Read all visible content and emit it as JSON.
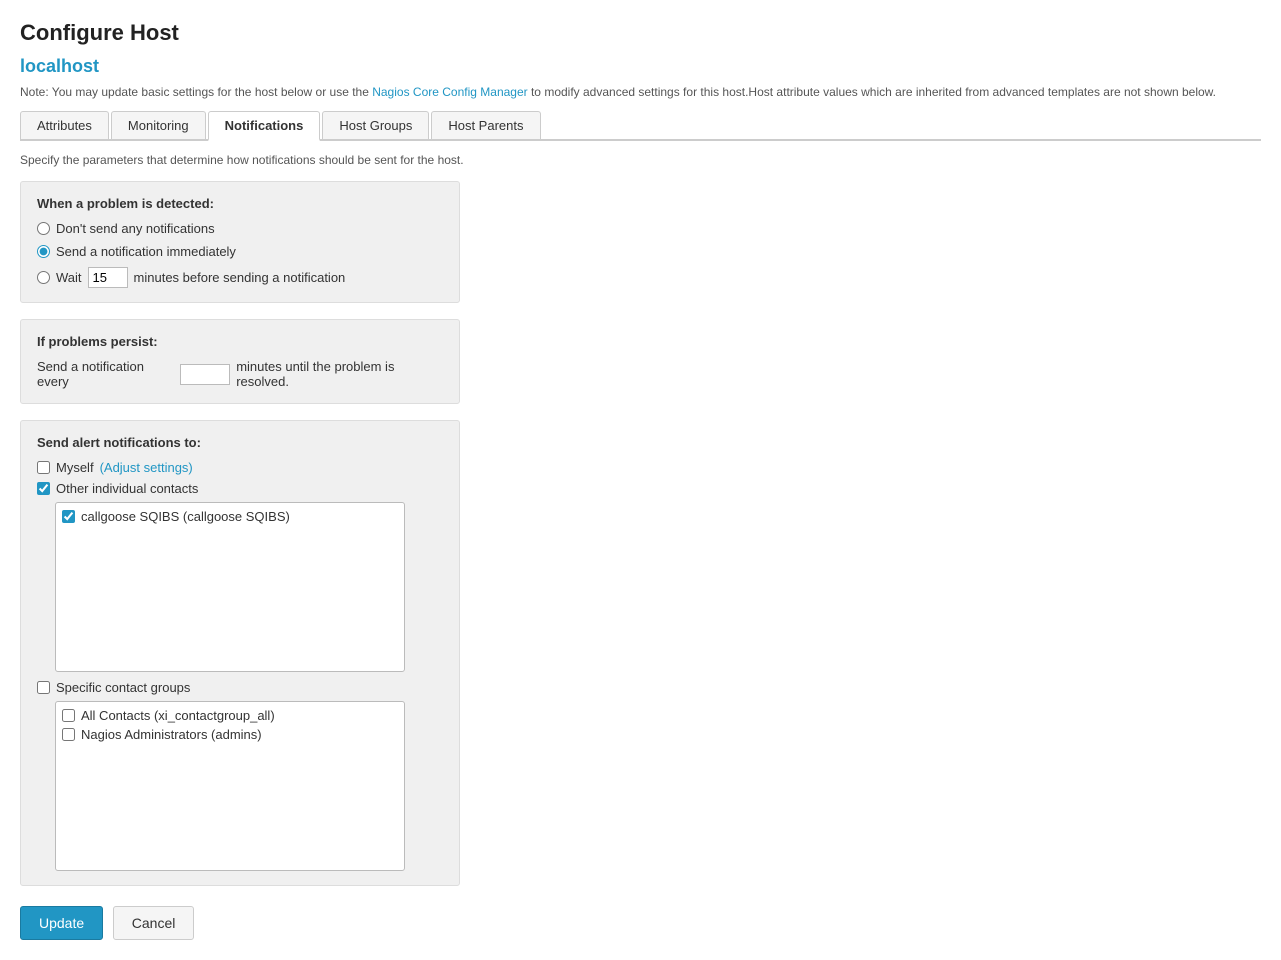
{
  "page": {
    "title": "Configure Host",
    "hostname": "localhost",
    "note_prefix": "Note: You may update basic settings for the host below or use the ",
    "note_link_text": "Nagios Core Config Manager",
    "note_suffix": " to modify advanced settings for this host.Host attribute values which are inherited from advanced templates are not shown below."
  },
  "tabs": [
    {
      "id": "attributes",
      "label": "Attributes",
      "active": false
    },
    {
      "id": "monitoring",
      "label": "Monitoring",
      "active": false
    },
    {
      "id": "notifications",
      "label": "Notifications",
      "active": true
    },
    {
      "id": "host-groups",
      "label": "Host Groups",
      "active": false
    },
    {
      "id": "host-parents",
      "label": "Host Parents",
      "active": false
    }
  ],
  "notifications": {
    "section_desc": "Specify the parameters that determine how notifications should be sent for the host.",
    "problem_panel": {
      "label": "When a problem is detected:",
      "options": [
        {
          "id": "no-notify",
          "label": "Don't send any notifications",
          "checked": false
        },
        {
          "id": "immediate",
          "label": "Send a notification immediately",
          "checked": true
        },
        {
          "id": "wait",
          "label": "minutes before sending a notification",
          "checked": false
        }
      ],
      "wait_value": "15",
      "wait_prefix": "Wait",
      "wait_suffix": "minutes before sending a notification"
    },
    "persist_panel": {
      "label": "If problems persist:",
      "prefix": "Send a notification every",
      "suffix": "minutes until the problem is resolved.",
      "value": ""
    },
    "alert_panel": {
      "label": "Send alert notifications to:",
      "myself_label": "Myself",
      "adjust_label": "(Adjust settings)",
      "myself_checked": false,
      "other_contacts_label": "Other individual contacts",
      "other_contacts_checked": true,
      "contacts": [
        {
          "label": "callgoose SQIBS (callgoose SQIBS)",
          "checked": true
        }
      ],
      "specific_groups_label": "Specific contact groups",
      "specific_groups_checked": false,
      "groups": [
        {
          "label": "All Contacts (xi_contactgroup_all)",
          "checked": false
        },
        {
          "label": "Nagios Administrators (admins)",
          "checked": false
        }
      ]
    }
  },
  "buttons": {
    "update_label": "Update",
    "cancel_label": "Cancel"
  }
}
